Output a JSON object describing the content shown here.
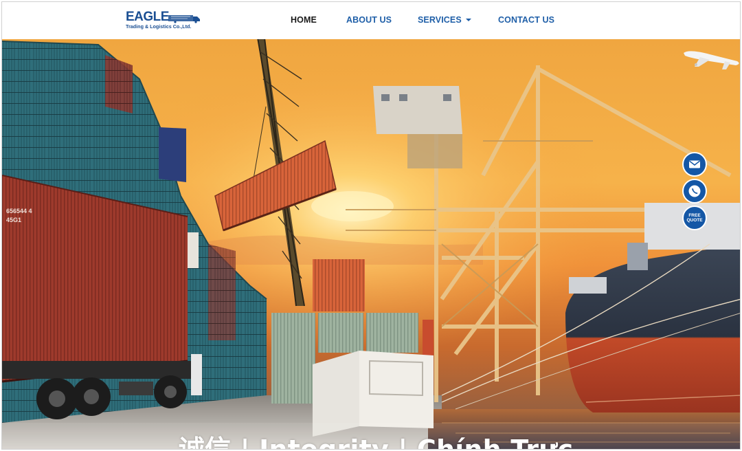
{
  "brand": {
    "name": "EAGLE",
    "subtitle": "Trading & Logistics Co.,Ltd.",
    "color": "#1b4f93"
  },
  "nav": {
    "items": [
      {
        "label": "HOME",
        "active": true
      },
      {
        "label": "ABOUT US",
        "active": false
      },
      {
        "label": "SERVICES",
        "active": false,
        "has_dropdown": true
      },
      {
        "label": "CONTACT US",
        "active": false
      }
    ],
    "link_color": "#1f5fa8",
    "active_color": "#1a1a1a"
  },
  "hero": {
    "image": "port-container-terminal-sunset",
    "tagline": "诚信 | Integrity | Chính Trực"
  },
  "floating_actions": [
    {
      "icon": "envelope-icon"
    },
    {
      "icon": "phone-icon"
    },
    {
      "label": "FREE QUOTE"
    }
  ],
  "accent": "#1457a6"
}
